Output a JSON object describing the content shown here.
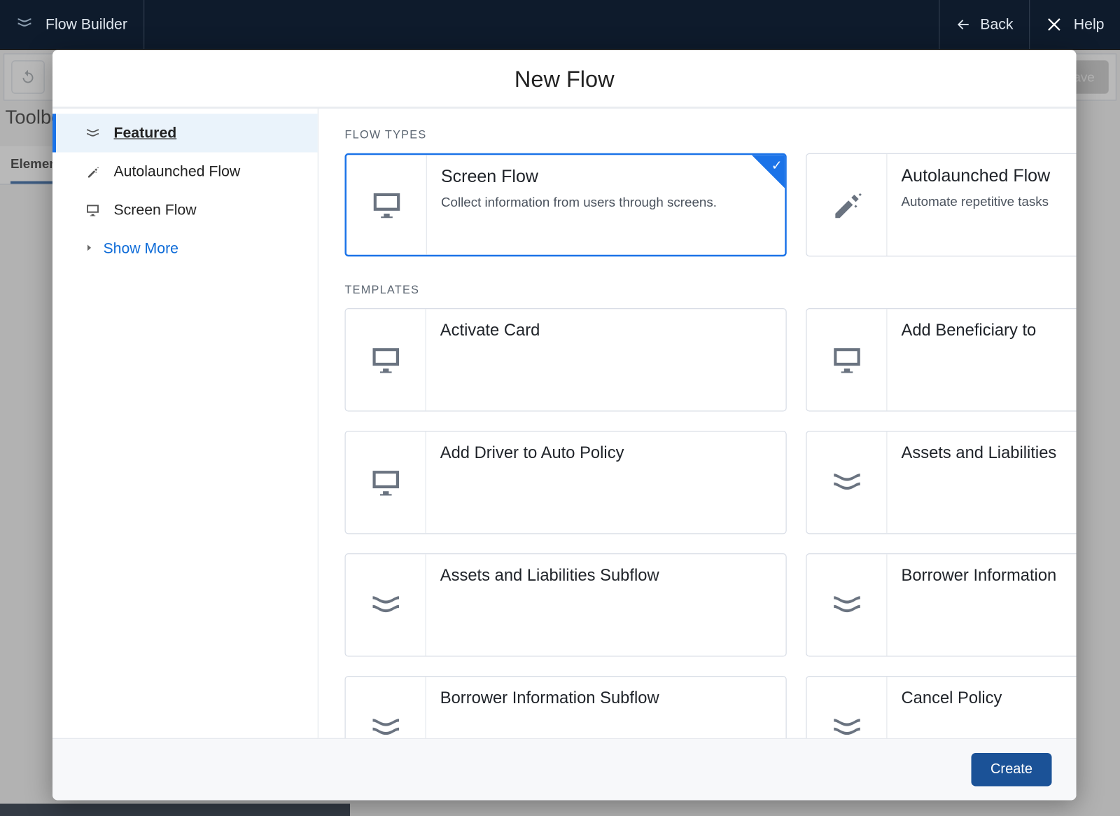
{
  "header": {
    "app_title": "Flow Builder",
    "back_label": "Back",
    "help_label": "Help"
  },
  "builder_bg": {
    "toolbox_label": "Toolbox",
    "elements_tab": "Elements",
    "save_label": "Save"
  },
  "modal": {
    "title": "New Flow",
    "sidebar": {
      "items": [
        {
          "label": "Featured",
          "icon": "flow"
        },
        {
          "label": "Autolaunched Flow",
          "icon": "wand"
        },
        {
          "label": "Screen Flow",
          "icon": "monitor"
        }
      ],
      "show_more": "Show More"
    },
    "section_flow_types": "FLOW TYPES",
    "section_templates": "TEMPLATES",
    "flow_types": [
      {
        "title": "Screen Flow",
        "desc": "Collect information from users through screens.",
        "icon": "monitor",
        "selected": true
      },
      {
        "title": "Autolaunched Flow",
        "desc": "Automate repetitive tasks",
        "icon": "wand",
        "selected": false
      }
    ],
    "templates": [
      {
        "title": "Activate Card",
        "icon": "monitor"
      },
      {
        "title": "Add Beneficiary to",
        "icon": "monitor"
      },
      {
        "title": "Add Driver to Auto Policy",
        "icon": "monitor"
      },
      {
        "title": "Assets and Liabilities",
        "icon": "flow"
      },
      {
        "title": "Assets and Liabilities Subflow",
        "icon": "flow"
      },
      {
        "title": "Borrower Information",
        "icon": "flow"
      },
      {
        "title": "Borrower Information Subflow",
        "icon": "flow"
      },
      {
        "title": "Cancel Policy",
        "icon": "flow"
      }
    ],
    "create_label": "Create"
  }
}
